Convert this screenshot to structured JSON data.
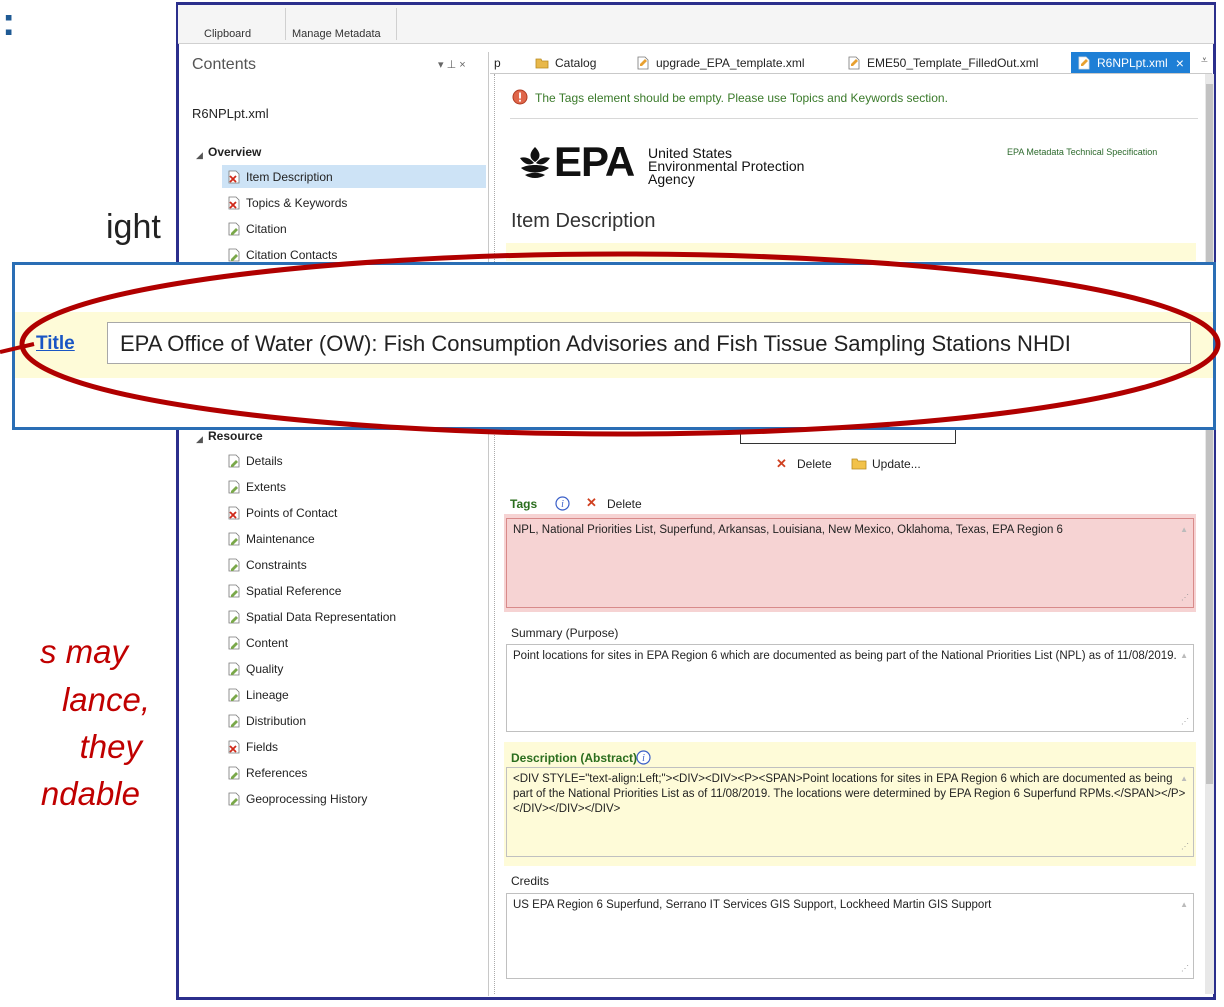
{
  "slide": {
    "colon": ":",
    "right_fragment": "ight",
    "italic_lines": [
      "s may",
      "lance,",
      "they",
      "ndable"
    ]
  },
  "ribbon": {
    "groups": [
      "Clipboard",
      "Manage Metadata"
    ]
  },
  "contents": {
    "title": "Contents",
    "pin_controls": "▾ ⊥ ×",
    "file": "R6NPLpt.xml",
    "overview_label": "Overview",
    "overview_items": [
      {
        "label": "Item Description",
        "icon": "document-error-icon",
        "selected": true
      },
      {
        "label": "Topics & Keywords",
        "icon": "document-error-icon"
      },
      {
        "label": "Citation",
        "icon": "document-edit-icon"
      },
      {
        "label": "Citation Contacts",
        "icon": "document-edit-icon"
      }
    ],
    "resource_label": "Resource",
    "resource_items": [
      {
        "label": "Details",
        "icon": "document-edit-icon"
      },
      {
        "label": "Extents",
        "icon": "document-edit-icon"
      },
      {
        "label": "Points of Contact",
        "icon": "document-error-icon"
      },
      {
        "label": "Maintenance",
        "icon": "document-edit-icon"
      },
      {
        "label": "Constraints",
        "icon": "document-edit-icon"
      },
      {
        "label": "Spatial Reference",
        "icon": "document-edit-icon"
      },
      {
        "label": "Spatial Data Representation",
        "icon": "document-edit-icon"
      },
      {
        "label": "Content",
        "icon": "document-edit-icon"
      },
      {
        "label": "Quality",
        "icon": "document-edit-icon"
      },
      {
        "label": "Lineage",
        "icon": "document-edit-icon"
      },
      {
        "label": "Distribution",
        "icon": "document-edit-icon"
      },
      {
        "label": "Fields",
        "icon": "document-error-icon"
      },
      {
        "label": "References",
        "icon": "document-edit-icon"
      },
      {
        "label": "Geoprocessing History",
        "icon": "document-edit-icon"
      }
    ]
  },
  "tabs": [
    {
      "label": "p"
    },
    {
      "label": "Catalog",
      "icon": "folder-icon"
    },
    {
      "label": "upgrade_EPA_template.xml",
      "icon": "xml-file-icon"
    },
    {
      "label": "EME50_Template_FilledOut.xml",
      "icon": "xml-file-icon"
    },
    {
      "label": "R6NPLpt.xml",
      "icon": "xml-file-icon",
      "active": true,
      "close": "×"
    }
  ],
  "document": {
    "warning": "The Tags element should be empty. Please use Topics and Keywords section.",
    "epa_name": "EPA",
    "epa_lines": [
      "United States",
      "Environmental Protection",
      "Agency"
    ],
    "spec": "EPA Metadata Technical Specification",
    "section_title": "Item Description",
    "delete_label": "Delete",
    "update_label": "Update...",
    "tags_label": "Tags",
    "tags_delete": "Delete",
    "tags_value": "NPL, National Priorities List, Superfund, Arkansas, Louisiana, New Mexico, Oklahoma, Texas, EPA Region 6",
    "summary_label": "Summary (Purpose)",
    "summary_value": "Point locations for sites in EPA Region 6 which are documented as being part of the National Priorities List (NPL) as of 11/08/2019.",
    "abstract_label": "Description (Abstract)",
    "abstract_value": "<DIV STYLE=\"text-align:Left;\"><DIV><DIV><P><SPAN>Point locations for sites in EPA Region 6 which are documented as being part of the National Priorities List as of 11/08/2019. The locations were determined by EPA Region 6 Superfund RPMs.</SPAN></P></DIV></DIV></DIV>",
    "credits_label": "Credits",
    "credits_value": "US EPA Region 6 Superfund, Serrano IT Services GIS Support, Lockheed Martin GIS Support"
  },
  "zoom": {
    "title_label": "Title",
    "title_value": "EPA Office of Water (OW): Fish Consumption Advisories and Fish Tissue Sampling Stations NHDI"
  },
  "colors": {
    "frame": "#2b2f8c",
    "callout": "#2a6eb5",
    "ellipse": "#b00000",
    "tab_active": "#1e7fd6",
    "tags_bg": "#f6d3d3",
    "abstract_bg": "#fefbd8"
  }
}
